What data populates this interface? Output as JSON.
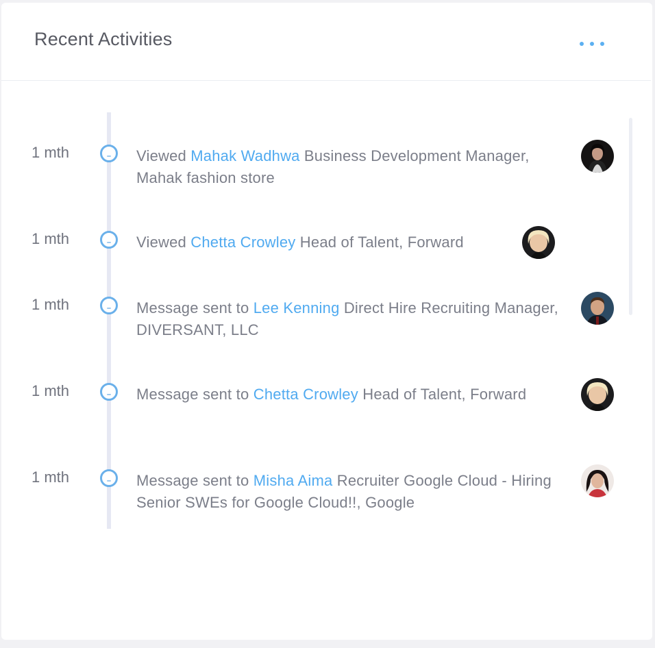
{
  "header": {
    "title": "Recent Activities",
    "menu_icon": "more-horizontal-icon"
  },
  "colors": {
    "accent": "#50aaf0",
    "timeline": "#e6e8f3",
    "text": "#7b7e89",
    "title": "#575962"
  },
  "activities": [
    {
      "time": "1 mth",
      "action": "Viewed",
      "person": "Mahak Wadhwa",
      "details": "Business Development Manager, Mahak fashion store"
    },
    {
      "time": "1 mth",
      "action": "Viewed",
      "person": "Chetta Crowley",
      "details": "Head of Talent, Forward"
    },
    {
      "time": "1 mth",
      "action": "Message sent to",
      "person": "Lee Kenning",
      "details": "Direct Hire Recruiting Manager, DIVERSANT, LLC"
    },
    {
      "time": "1 mth",
      "action": "Message sent to",
      "person": "Chetta Crowley",
      "details": "Head of Talent, Forward"
    },
    {
      "time": "1 mth",
      "action": "Message sent to",
      "person": "Misha Aima",
      "details": "Recruiter Google Cloud - Hiring Senior SWEs for Google Cloud!!, Google"
    }
  ]
}
